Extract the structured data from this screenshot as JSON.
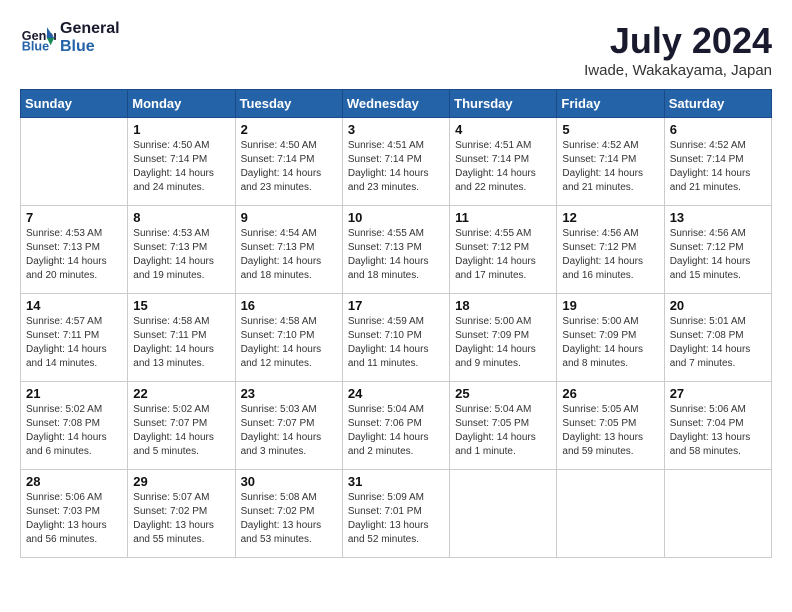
{
  "header": {
    "logo_line1": "General",
    "logo_line2": "Blue",
    "month_title": "July 2024",
    "location": "Iwade, Wakakayama, Japan"
  },
  "weekdays": [
    "Sunday",
    "Monday",
    "Tuesday",
    "Wednesday",
    "Thursday",
    "Friday",
    "Saturday"
  ],
  "weeks": [
    [
      {
        "day": "",
        "info": ""
      },
      {
        "day": "1",
        "info": "Sunrise: 4:50 AM\nSunset: 7:14 PM\nDaylight: 14 hours\nand 24 minutes."
      },
      {
        "day": "2",
        "info": "Sunrise: 4:50 AM\nSunset: 7:14 PM\nDaylight: 14 hours\nand 23 minutes."
      },
      {
        "day": "3",
        "info": "Sunrise: 4:51 AM\nSunset: 7:14 PM\nDaylight: 14 hours\nand 23 minutes."
      },
      {
        "day": "4",
        "info": "Sunrise: 4:51 AM\nSunset: 7:14 PM\nDaylight: 14 hours\nand 22 minutes."
      },
      {
        "day": "5",
        "info": "Sunrise: 4:52 AM\nSunset: 7:14 PM\nDaylight: 14 hours\nand 21 minutes."
      },
      {
        "day": "6",
        "info": "Sunrise: 4:52 AM\nSunset: 7:14 PM\nDaylight: 14 hours\nand 21 minutes."
      }
    ],
    [
      {
        "day": "7",
        "info": "Sunrise: 4:53 AM\nSunset: 7:13 PM\nDaylight: 14 hours\nand 20 minutes."
      },
      {
        "day": "8",
        "info": "Sunrise: 4:53 AM\nSunset: 7:13 PM\nDaylight: 14 hours\nand 19 minutes."
      },
      {
        "day": "9",
        "info": "Sunrise: 4:54 AM\nSunset: 7:13 PM\nDaylight: 14 hours\nand 18 minutes."
      },
      {
        "day": "10",
        "info": "Sunrise: 4:55 AM\nSunset: 7:13 PM\nDaylight: 14 hours\nand 18 minutes."
      },
      {
        "day": "11",
        "info": "Sunrise: 4:55 AM\nSunset: 7:12 PM\nDaylight: 14 hours\nand 17 minutes."
      },
      {
        "day": "12",
        "info": "Sunrise: 4:56 AM\nSunset: 7:12 PM\nDaylight: 14 hours\nand 16 minutes."
      },
      {
        "day": "13",
        "info": "Sunrise: 4:56 AM\nSunset: 7:12 PM\nDaylight: 14 hours\nand 15 minutes."
      }
    ],
    [
      {
        "day": "14",
        "info": "Sunrise: 4:57 AM\nSunset: 7:11 PM\nDaylight: 14 hours\nand 14 minutes."
      },
      {
        "day": "15",
        "info": "Sunrise: 4:58 AM\nSunset: 7:11 PM\nDaylight: 14 hours\nand 13 minutes."
      },
      {
        "day": "16",
        "info": "Sunrise: 4:58 AM\nSunset: 7:10 PM\nDaylight: 14 hours\nand 12 minutes."
      },
      {
        "day": "17",
        "info": "Sunrise: 4:59 AM\nSunset: 7:10 PM\nDaylight: 14 hours\nand 11 minutes."
      },
      {
        "day": "18",
        "info": "Sunrise: 5:00 AM\nSunset: 7:09 PM\nDaylight: 14 hours\nand 9 minutes."
      },
      {
        "day": "19",
        "info": "Sunrise: 5:00 AM\nSunset: 7:09 PM\nDaylight: 14 hours\nand 8 minutes."
      },
      {
        "day": "20",
        "info": "Sunrise: 5:01 AM\nSunset: 7:08 PM\nDaylight: 14 hours\nand 7 minutes."
      }
    ],
    [
      {
        "day": "21",
        "info": "Sunrise: 5:02 AM\nSunset: 7:08 PM\nDaylight: 14 hours\nand 6 minutes."
      },
      {
        "day": "22",
        "info": "Sunrise: 5:02 AM\nSunset: 7:07 PM\nDaylight: 14 hours\nand 5 minutes."
      },
      {
        "day": "23",
        "info": "Sunrise: 5:03 AM\nSunset: 7:07 PM\nDaylight: 14 hours\nand 3 minutes."
      },
      {
        "day": "24",
        "info": "Sunrise: 5:04 AM\nSunset: 7:06 PM\nDaylight: 14 hours\nand 2 minutes."
      },
      {
        "day": "25",
        "info": "Sunrise: 5:04 AM\nSunset: 7:05 PM\nDaylight: 14 hours\nand 1 minute."
      },
      {
        "day": "26",
        "info": "Sunrise: 5:05 AM\nSunset: 7:05 PM\nDaylight: 13 hours\nand 59 minutes."
      },
      {
        "day": "27",
        "info": "Sunrise: 5:06 AM\nSunset: 7:04 PM\nDaylight: 13 hours\nand 58 minutes."
      }
    ],
    [
      {
        "day": "28",
        "info": "Sunrise: 5:06 AM\nSunset: 7:03 PM\nDaylight: 13 hours\nand 56 minutes."
      },
      {
        "day": "29",
        "info": "Sunrise: 5:07 AM\nSunset: 7:02 PM\nDaylight: 13 hours\nand 55 minutes."
      },
      {
        "day": "30",
        "info": "Sunrise: 5:08 AM\nSunset: 7:02 PM\nDaylight: 13 hours\nand 53 minutes."
      },
      {
        "day": "31",
        "info": "Sunrise: 5:09 AM\nSunset: 7:01 PM\nDaylight: 13 hours\nand 52 minutes."
      },
      {
        "day": "",
        "info": ""
      },
      {
        "day": "",
        "info": ""
      },
      {
        "day": "",
        "info": ""
      }
    ]
  ]
}
